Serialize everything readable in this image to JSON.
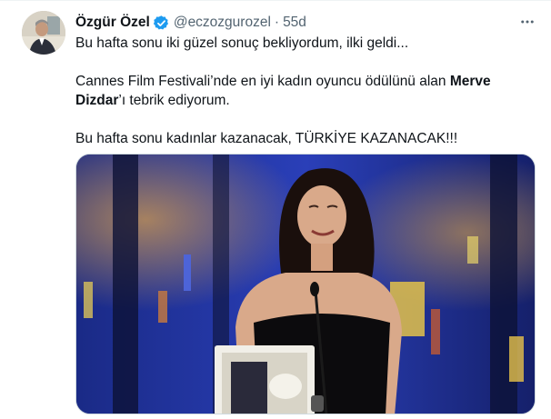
{
  "tweet": {
    "author": {
      "display_name": "Özgür Özel",
      "handle": "@eczozgurozel",
      "verified": true,
      "verified_color": "#1d9bf0"
    },
    "separator": "·",
    "age": "55d",
    "more_icon": "more-horizontal-icon",
    "text": {
      "line1": "Bu hafta sonu iki güzel sonuç bekliyordum, ilki geldi...",
      "line2_pre": "Cannes Film Festivali’nde en iyi kadın oyuncu ödülünü alan ",
      "line2_bold": "Merve Dizdar",
      "line2_post": "’ı tebrik ediyorum.",
      "line3": "Bu hafta sonu kadınlar kazanacak, TÜRKİYE KAZANACAK!!!"
    },
    "media": {
      "kind": "photo"
    }
  }
}
